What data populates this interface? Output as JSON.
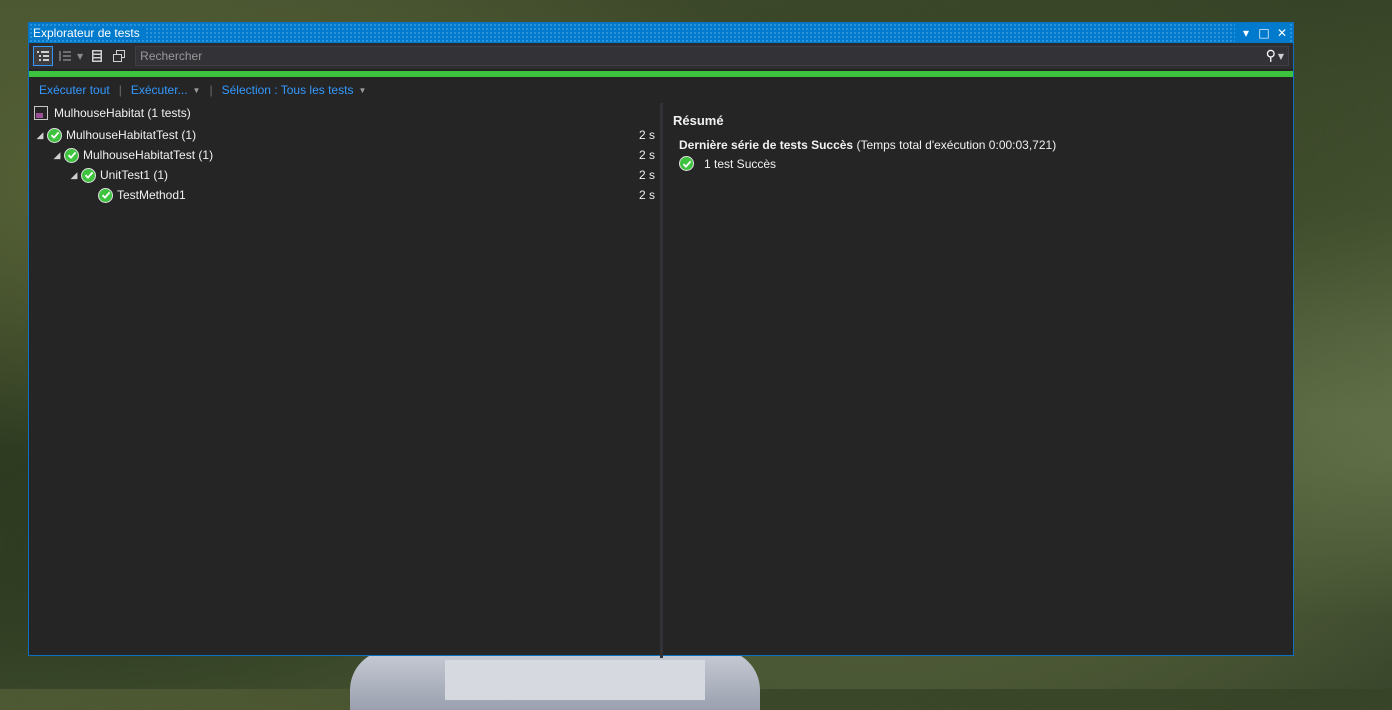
{
  "window": {
    "title": "Explorateur de tests",
    "controls": {
      "dropdown": "▾",
      "maximize": "□",
      "close": "✕"
    }
  },
  "toolbar": {
    "search_placeholder": "Rechercher"
  },
  "actions": {
    "run_all": "Exécuter tout",
    "run": "Exécuter...",
    "selection": "Sélection : Tous les tests"
  },
  "tree": {
    "project": "MulhouseHabitat (1 tests)",
    "items": [
      {
        "label": "MulhouseHabitatTest (1)",
        "duration": "2 s"
      },
      {
        "label": "MulhouseHabitatTest (1)",
        "duration": "2 s"
      },
      {
        "label": "UnitTest1 (1)",
        "duration": "2 s"
      },
      {
        "label": "TestMethod1",
        "duration": "2 s"
      }
    ]
  },
  "summary": {
    "title": "Résumé",
    "last_run_label": "Dernière série de tests Succès",
    "last_run_time": "(Temps total d'exécution 0:00:03,721)",
    "result": "1 test Succès"
  },
  "colors": {
    "accent": "#007acc",
    "success": "#3ec33e",
    "link": "#3399ff",
    "panel": "#252526"
  }
}
